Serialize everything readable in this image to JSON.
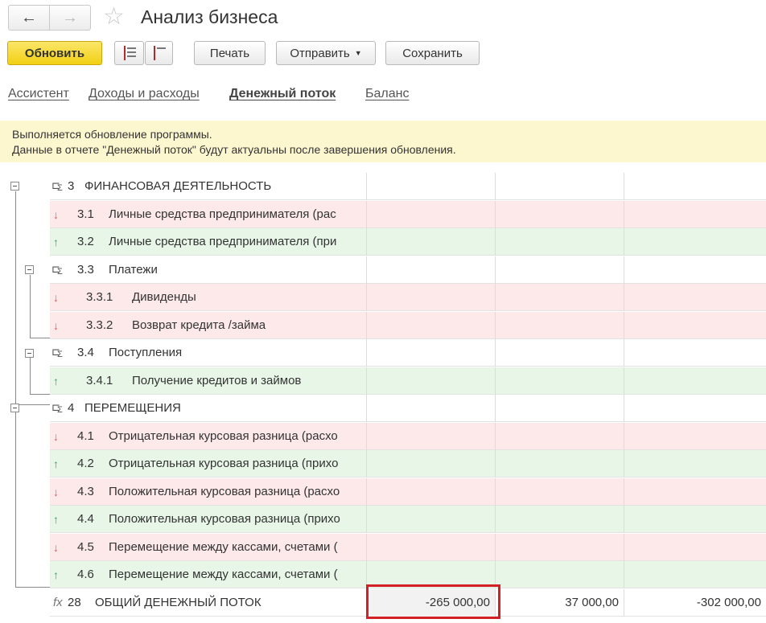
{
  "window": {
    "title": "Анализ бизнеса",
    "nav_back_icon": "←",
    "nav_forward_icon": "→",
    "favorite_icon": "☆"
  },
  "toolbar": {
    "refresh_label": "Обновить",
    "print_label": "Печать",
    "send_label": "Отправить",
    "send_caret": "▼",
    "save_label": "Сохранить"
  },
  "tabs": [
    {
      "label": "Ассистент"
    },
    {
      "label": "Доходы и расходы"
    },
    {
      "label": "Денежный поток",
      "active": true
    },
    {
      "label": "Баланс"
    }
  ],
  "notice": {
    "line1": "Выполняется обновление программы.",
    "line2": "Данные в отчете \"Денежный поток\" будут актуальны после завершения обновления."
  },
  "rows": [
    {
      "type": "group",
      "code": "3",
      "label": "ФИНАНСОВАЯ ДЕЯТЕЛЬНОСТЬ"
    },
    {
      "type": "expense",
      "code": "3.1",
      "label": "Личные средства предпринимателя (рас"
    },
    {
      "type": "income",
      "code": "3.2",
      "label": "Личные средства предпринимателя (при"
    },
    {
      "type": "group",
      "code": "3.3",
      "label": "Платежи"
    },
    {
      "type": "expense",
      "code": "3.3.1",
      "label": "Дивиденды"
    },
    {
      "type": "expense",
      "code": "3.3.2",
      "label": "Возврат кредита /займа"
    },
    {
      "type": "group",
      "code": "3.4",
      "label": "Поступления"
    },
    {
      "type": "income",
      "code": "3.4.1",
      "label": "Получение кредитов и займов"
    },
    {
      "type": "group",
      "code": "4",
      "label": "ПЕРЕМЕЩЕНИЯ"
    },
    {
      "type": "expense",
      "code": "4.1",
      "label": "Отрицательная курсовая разница (расхо"
    },
    {
      "type": "income",
      "code": "4.2",
      "label": "Отрицательная курсовая разница (прихо"
    },
    {
      "type": "expense",
      "code": "4.3",
      "label": "Положительная курсовая разница (расхо"
    },
    {
      "type": "income",
      "code": "4.4",
      "label": "Положительная курсовая разница (прихо"
    },
    {
      "type": "expense",
      "code": "4.5",
      "label": "Перемещение между кассами, счетами ("
    },
    {
      "type": "income",
      "code": "4.6",
      "label": "Перемещение между кассами, счетами ("
    }
  ],
  "total": {
    "icon": "fx",
    "code": "28",
    "label": "ОБЩИЙ ДЕНЕЖНЫЙ ПОТОК",
    "col1": "-265 000,00",
    "col2": "37 000,00",
    "col3": "-302 000,00"
  },
  "icons": {
    "down_arrow": "↓",
    "up_arrow": "↑",
    "group_icon": "group-sum-icon"
  }
}
